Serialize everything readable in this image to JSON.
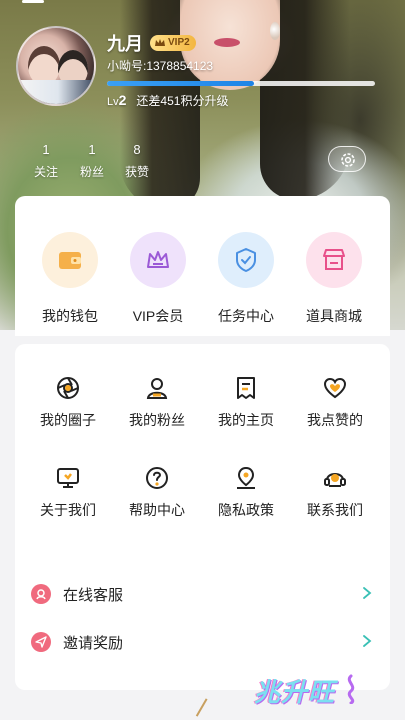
{
  "profile": {
    "username": "九月",
    "vip_badge": "VIP2",
    "account_id": "小呦号:1378854123",
    "level_label": "Lv",
    "level_number": "2",
    "level_progress": 0.55,
    "points_needed": "还差451积分升级"
  },
  "stats": [
    {
      "value": "1",
      "label": "关注"
    },
    {
      "value": "1",
      "label": "粉丝"
    },
    {
      "value": "8",
      "label": "获赞"
    }
  ],
  "quick_actions": [
    {
      "label": "我的钱包",
      "icon": "wallet-icon",
      "color": "#f5a623"
    },
    {
      "label": "VIP会员",
      "icon": "crown-icon",
      "color": "#9b59d6"
    },
    {
      "label": "任务中心",
      "icon": "shield-check-icon",
      "color": "#4a90e2"
    },
    {
      "label": "道具商城",
      "icon": "shop-icon",
      "color": "#e8508a"
    }
  ],
  "menu_grid": [
    {
      "label": "我的圈子",
      "icon": "aperture-icon"
    },
    {
      "label": "我的粉丝",
      "icon": "user-icon"
    },
    {
      "label": "我的主页",
      "icon": "document-icon"
    },
    {
      "label": "我点赞的",
      "icon": "heart-icon"
    },
    {
      "label": "关于我们",
      "icon": "monitor-icon"
    },
    {
      "label": "帮助中心",
      "icon": "help-icon"
    },
    {
      "label": "隐私政策",
      "icon": "location-pin-icon"
    },
    {
      "label": "联系我们",
      "icon": "headset-icon"
    }
  ],
  "list": [
    {
      "label": "在线客服",
      "icon": "customer-service-icon",
      "color": "#f06a7e"
    },
    {
      "label": "邀请奖励",
      "icon": "send-icon",
      "color": "#f06a7e"
    }
  ],
  "watermark": "兆升旺",
  "colors": {
    "accent_teal": "#39c0b5",
    "progress_blue": "#1e84e6",
    "vip_gold": "#f3b640"
  }
}
